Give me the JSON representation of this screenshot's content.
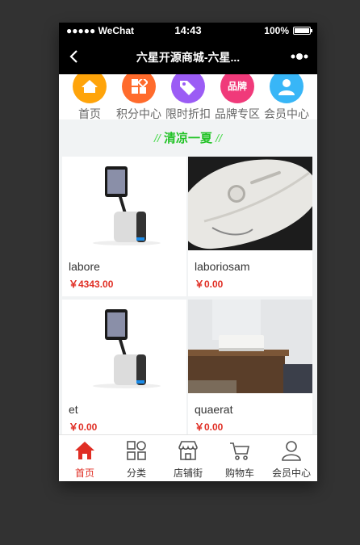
{
  "status_bar": {
    "signal": "●●●●● WeChat",
    "time": "14:43",
    "battery": "100%"
  },
  "nav_bar": {
    "title": "六星开源商城-六星..."
  },
  "quick_nav": [
    {
      "label": "首页",
      "color": "#ffa40a",
      "icon": "home-icon"
    },
    {
      "label": "积分中心",
      "color": "#ff6b2c",
      "icon": "grid-icon"
    },
    {
      "label": "限时折扣",
      "color": "#9b5cf5",
      "icon": "tag-icon"
    },
    {
      "label": "品牌专区",
      "color": "#f03a7a",
      "icon": "brand-icon",
      "badge": "品牌"
    },
    {
      "label": "会员中心",
      "color": "#38b6f7",
      "icon": "user-icon"
    }
  ],
  "section": {
    "title": "清凉一夏",
    "slash_left": "//",
    "slash_right": "//"
  },
  "products": [
    {
      "name": "labore",
      "price": "￥4343.00",
      "image": "kiosk-stand"
    },
    {
      "name": "laboriosam",
      "price": "￥0.00",
      "image": "white-mouse"
    },
    {
      "name": "et",
      "price": "￥0.00",
      "image": "kiosk-stand"
    },
    {
      "name": "quaerat",
      "price": "￥0.00",
      "image": "speaker-shelf"
    }
  ],
  "tab_bar": [
    {
      "label": "首页",
      "icon": "home-icon",
      "active": true
    },
    {
      "label": "分类",
      "icon": "category-icon"
    },
    {
      "label": "店铺街",
      "icon": "store-icon"
    },
    {
      "label": "购物车",
      "icon": "cart-icon"
    },
    {
      "label": "会员中心",
      "icon": "user-icon"
    }
  ],
  "colors": {
    "accent_red": "#e02e24",
    "section_green": "#22c326"
  }
}
